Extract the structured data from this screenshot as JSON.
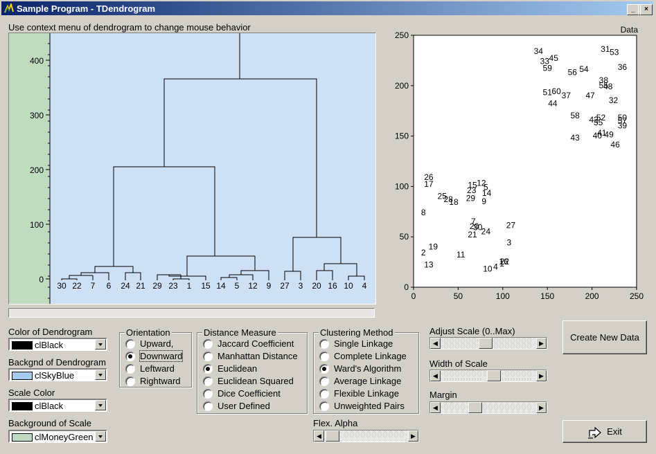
{
  "window": {
    "title": "Sample Program - TDendrogram",
    "minimize": "_",
    "maximize": "□",
    "close": "×"
  },
  "hint": "Use context menu of dendrogram to change mouse behavior",
  "colors": {
    "dendro_bg": "#cee0f4",
    "scale_bg": "#bfdbc0",
    "black": "#000000"
  },
  "dendrogram": {
    "scale_ticks": [
      "400",
      "300",
      "200",
      "100",
      "0"
    ],
    "leaves": [
      "30",
      "22",
      "7",
      "6",
      "24",
      "21",
      "29",
      "23",
      "1",
      "15",
      "14",
      "5",
      "12",
      "9",
      "27",
      "3",
      "20",
      "16",
      "10",
      "4"
    ]
  },
  "scatter": {
    "title": "Data",
    "x_ticks": [
      "0",
      "50",
      "100",
      "150",
      "200",
      "250"
    ],
    "y_ticks": [
      "250",
      "200",
      "150",
      "100",
      "50",
      "0"
    ],
    "points": [
      {
        "id": "34",
        "x": 140,
        "y": 235
      },
      {
        "id": "33",
        "x": 147,
        "y": 225
      },
      {
        "id": "45",
        "x": 157,
        "y": 228
      },
      {
        "id": "59",
        "x": 150,
        "y": 218
      },
      {
        "id": "31",
        "x": 215,
        "y": 237
      },
      {
        "id": "53",
        "x": 225,
        "y": 234
      },
      {
        "id": "36",
        "x": 234,
        "y": 219
      },
      {
        "id": "54",
        "x": 191,
        "y": 217
      },
      {
        "id": "56",
        "x": 178,
        "y": 214
      },
      {
        "id": "38",
        "x": 213,
        "y": 206
      },
      {
        "id": "55",
        "x": 213,
        "y": 201
      },
      {
        "id": "48",
        "x": 218,
        "y": 200
      },
      {
        "id": "51",
        "x": 150,
        "y": 194
      },
      {
        "id": "60",
        "x": 160,
        "y": 195
      },
      {
        "id": "37",
        "x": 171,
        "y": 191
      },
      {
        "id": "47",
        "x": 198,
        "y": 191
      },
      {
        "id": "44",
        "x": 156,
        "y": 183
      },
      {
        "id": "32",
        "x": 224,
        "y": 186
      },
      {
        "id": "58",
        "x": 181,
        "y": 171
      },
      {
        "id": "52",
        "x": 210,
        "y": 169
      },
      {
        "id": "50",
        "x": 234,
        "y": 169
      },
      {
        "id": "42",
        "x": 202,
        "y": 167
      },
      {
        "id": "35",
        "x": 207,
        "y": 164
      },
      {
        "id": "57",
        "x": 234,
        "y": 166
      },
      {
        "id": "39",
        "x": 234,
        "y": 161
      },
      {
        "id": "41",
        "x": 211,
        "y": 154
      },
      {
        "id": "49",
        "x": 219,
        "y": 152
      },
      {
        "id": "40",
        "x": 206,
        "y": 151
      },
      {
        "id": "43",
        "x": 181,
        "y": 149
      },
      {
        "id": "46",
        "x": 226,
        "y": 142
      },
      {
        "id": "26",
        "x": 17,
        "y": 110
      },
      {
        "id": "17",
        "x": 17,
        "y": 103
      },
      {
        "id": "12",
        "x": 76,
        "y": 104
      },
      {
        "id": "15",
        "x": 66,
        "y": 102
      },
      {
        "id": "5",
        "x": 81,
        "y": 100
      },
      {
        "id": "23",
        "x": 65,
        "y": 97
      },
      {
        "id": "14",
        "x": 82,
        "y": 94
      },
      {
        "id": "25",
        "x": 32,
        "y": 91
      },
      {
        "id": "29",
        "x": 64,
        "y": 89
      },
      {
        "id": "28",
        "x": 39,
        "y": 88
      },
      {
        "id": "18",
        "x": 45,
        "y": 85
      },
      {
        "id": "9",
        "x": 79,
        "y": 86
      },
      {
        "id": "8",
        "x": 11,
        "y": 75
      },
      {
        "id": "7",
        "x": 67,
        "y": 66
      },
      {
        "id": "20",
        "x": 68,
        "y": 61
      },
      {
        "id": "30",
        "x": 72,
        "y": 60
      },
      {
        "id": "27",
        "x": 109,
        "y": 62
      },
      {
        "id": "24",
        "x": 81,
        "y": 56
      },
      {
        "id": "21",
        "x": 66,
        "y": 53
      },
      {
        "id": "3",
        "x": 107,
        "y": 45
      },
      {
        "id": "19",
        "x": 22,
        "y": 41
      },
      {
        "id": "2",
        "x": 11,
        "y": 35
      },
      {
        "id": "11",
        "x": 53,
        "y": 33
      },
      {
        "id": "13",
        "x": 17,
        "y": 23
      },
      {
        "id": "16",
        "x": 101,
        "y": 26
      },
      {
        "id": "22",
        "x": 102,
        "y": 26
      },
      {
        "id": "1",
        "x": 99,
        "y": 24
      },
      {
        "id": "4",
        "x": 92,
        "y": 21
      },
      {
        "id": "10",
        "x": 83,
        "y": 19
      }
    ]
  },
  "controls": {
    "color_dendro_label": "Color of Dendrogram",
    "color_dendro_value": "clBlack",
    "color_dendro_swatch": "#000000",
    "bg_dendro_label": "Backgnd of Dendrogram",
    "bg_dendro_value": "clSkyBlue",
    "bg_dendro_swatch": "#a6caf0",
    "scale_color_label": "Scale Color",
    "scale_color_value": "clBlack",
    "scale_color_swatch": "#000000",
    "scale_bg_label": "Background of Scale",
    "scale_bg_value": "clMoneyGreen",
    "scale_bg_swatch": "#c0dcc0",
    "orientation": {
      "title": "Orientation",
      "options": [
        "Upward,",
        "Downward",
        "Leftward",
        "Rightward"
      ],
      "selected": 1
    },
    "distance": {
      "title": "Distance Measure",
      "options": [
        "Jaccard Coefficient",
        "Manhattan Distance",
        "Euclidean",
        "Euclidean Squared",
        "Dice Coefficient",
        "User Defined"
      ],
      "selected": 2
    },
    "clustering": {
      "title": "Clustering Method",
      "options": [
        "Single Linkage",
        "Complete Linkage",
        "Ward's Algorithm",
        "Average Linkage",
        "Flexible Linkage",
        "Unweighted Pairs"
      ],
      "selected": 2
    },
    "flex_alpha_label": "Flex. Alpha",
    "adjust_scale_label": "Adjust Scale (0..Max)",
    "width_scale_label": "Width of Scale",
    "margin_label": "Margin",
    "adjust_scale_level": 0.47,
    "width_scale_level": 0.57,
    "margin_level": 0.34,
    "flex_alpha_level": 0.02,
    "create_button": "Create New Data",
    "exit_button": "Exit"
  }
}
